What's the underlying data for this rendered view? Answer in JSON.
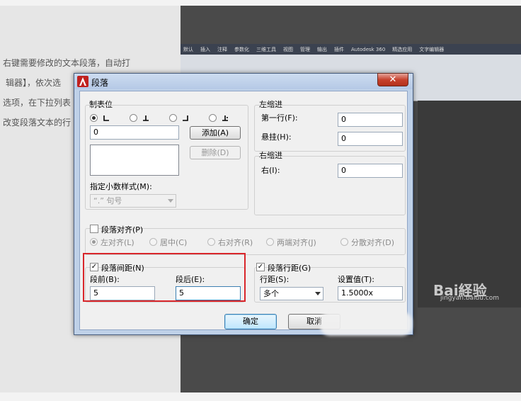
{
  "background": {
    "article_lines": [
      "右键需要修改的文本段落，自动打",
      "辑器】，依次选",
      "选项，在下拉列表",
      "改变段落文本的行"
    ],
    "ribbon_tabs": [
      "默认",
      "插入",
      "注释",
      "参数化",
      "三维工具",
      "视图",
      "管理",
      "输出",
      "插件",
      "Autodesk 360",
      "精选应用",
      "文字编辑器"
    ],
    "watermark_main": "Bai経验",
    "watermark_sub": "jingyan.baidu.com"
  },
  "dialog": {
    "title": "段落",
    "close_symbol": "✕",
    "tabs_group": {
      "label": "制表位",
      "tab_value": "0",
      "add_button": "添加(A)",
      "delete_button": "删除(D)",
      "decimal_label": "指定小数样式(M):",
      "decimal_value": "“.” 句号"
    },
    "left_indent": {
      "label": "左缩进",
      "first_line_label": "第一行(F):",
      "first_line_value": "0",
      "hanging_label": "悬挂(H):",
      "hanging_value": "0"
    },
    "right_indent": {
      "label": "右缩进",
      "right_label": "右(I):",
      "right_value": "0"
    },
    "alignment": {
      "label": "段落对齐(P)",
      "options": [
        "左对齐(L)",
        "居中(C)",
        "右对齐(R)",
        "两端对齐(J)",
        "分散对齐(D)"
      ]
    },
    "spacing": {
      "label": "段落间距(N)",
      "before_label": "段前(B):",
      "before_value": "5",
      "after_label": "段后(E):",
      "after_value": "5"
    },
    "line_spacing": {
      "label": "段落行距(G)",
      "type_label": "行距(S):",
      "type_value": "多个",
      "value_label": "设置值(T):",
      "value": "1.5000x"
    },
    "ok_button": "确定",
    "cancel_button": "取消"
  }
}
